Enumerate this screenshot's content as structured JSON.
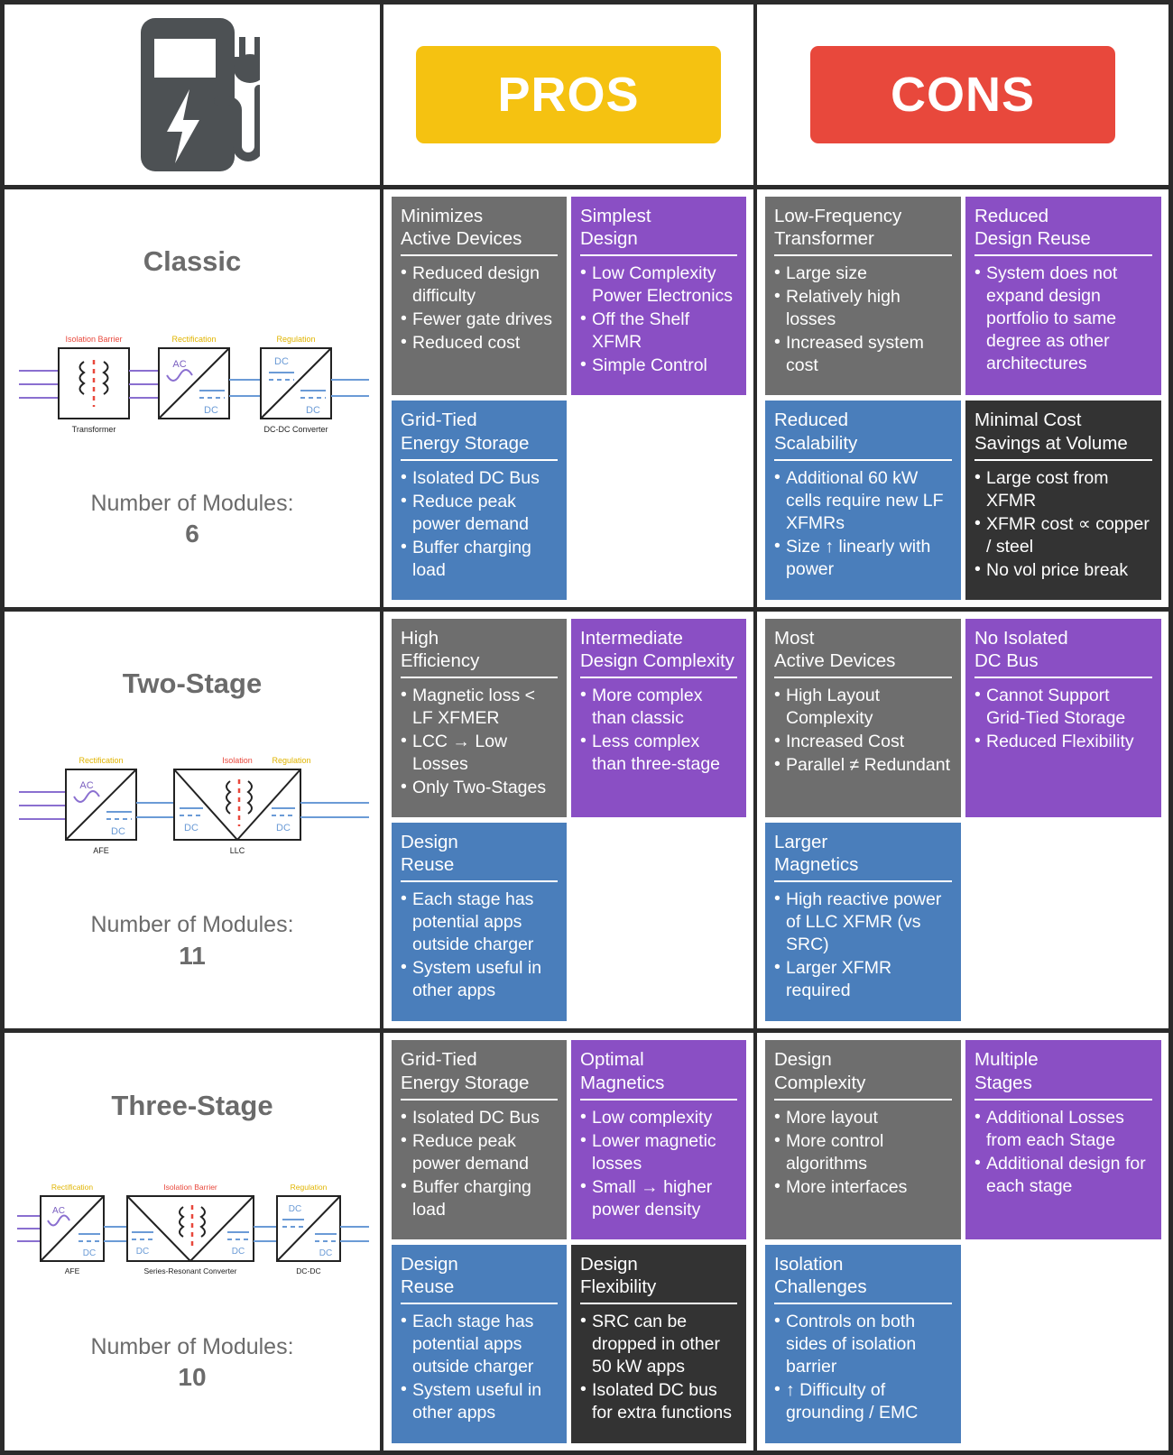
{
  "header": {
    "icon": "ev-charger-icon",
    "pros_label": "PROS",
    "cons_label": "CONS",
    "pros_color": "#f5c211",
    "cons_color": "#e8483c"
  },
  "palette": {
    "gray": "#6e6e6e",
    "purple": "#8a4fc4",
    "blue": "#4a7ebb",
    "dark": "#333333",
    "isolation_label": "#e8483c",
    "stage_label": "#f0c808",
    "ac_line": "#8a6fd0",
    "dc_line": "#6b9bd6"
  },
  "rows": [
    {
      "title": "Classic",
      "modules_label": "Number of Modules:",
      "modules_count": "6",
      "diagram": {
        "blocks": [
          {
            "top_label": "Isolation Barrier",
            "top_label_color": "isolation",
            "bottom_label": "Transformer",
            "kind": "transformer"
          },
          {
            "top_label": "Rectification",
            "top_label_color": "stage",
            "bottom_label": "",
            "kind": "ac-dc"
          },
          {
            "top_label": "Regulation",
            "top_label_color": "stage",
            "bottom_label": "DC-DC Converter",
            "kind": "dc-dc"
          }
        ]
      },
      "pros": [
        {
          "color": "gray",
          "title": "Minimizes\nActive Devices",
          "items": [
            "Reduced design difficulty",
            "Fewer gate drives",
            "Reduced cost"
          ]
        },
        {
          "color": "purple",
          "title": "Simplest\nDesign",
          "items": [
            "Low Complexity Power Electronics",
            "Off the Shelf XFMR",
            "Simple Control"
          ]
        },
        {
          "color": "blue",
          "title": "Grid-Tied\nEnergy Storage",
          "items": [
            "Isolated DC Bus",
            "Reduce peak power demand",
            "Buffer charging load"
          ]
        },
        {
          "color": "empty",
          "title": "",
          "items": []
        }
      ],
      "cons": [
        {
          "color": "gray",
          "title": "Low-Frequency\nTransformer",
          "items": [
            "Large size",
            "Relatively high losses",
            "Increased system cost"
          ]
        },
        {
          "color": "purple",
          "title": "Reduced\nDesign Reuse",
          "items": [
            "System does not expand design portfolio to same degree as other architectures"
          ]
        },
        {
          "color": "blue",
          "title": "Reduced\nScalability",
          "items": [
            "Additional 60 kW cells require new LF XFMRs",
            "Size ↑ linearly with power"
          ]
        },
        {
          "color": "dark",
          "title": "Minimal Cost\nSavings at Volume",
          "items": [
            "Large cost from XFMR",
            "XFMR cost ∝ copper / steel",
            "No vol price break"
          ]
        }
      ]
    },
    {
      "title": "Two-Stage",
      "modules_label": "Number of Modules:",
      "modules_count": "11",
      "diagram": {
        "blocks": [
          {
            "top_label": "Rectification",
            "top_label_color": "stage",
            "bottom_label": "AFE",
            "kind": "ac-dc"
          },
          {
            "top_label": "Isolation  Regulation",
            "top_label_color": "mixed",
            "bottom_label": "LLC",
            "kind": "iso-dc-dc"
          }
        ]
      },
      "pros": [
        {
          "color": "gray",
          "title": "High\nEfficiency",
          "items": [
            "Magnetic loss < LF XFMER",
            "LCC → Low Losses",
            "Only Two-Stages"
          ]
        },
        {
          "color": "purple",
          "title": "Intermediate\nDesign Complexity",
          "items": [
            "More complex than classic",
            "Less complex than three-stage"
          ]
        },
        {
          "color": "blue",
          "title": "Design\nReuse",
          "items": [
            "Each stage has potential apps outside charger",
            "System useful in other apps"
          ]
        },
        {
          "color": "empty",
          "title": "",
          "items": []
        }
      ],
      "cons": [
        {
          "color": "gray",
          "title": "Most\nActive Devices",
          "items": [
            "High Layout Complexity",
            "Increased Cost",
            "Parallel ≠ Redundant"
          ]
        },
        {
          "color": "purple",
          "title": "No Isolated\nDC Bus",
          "items": [
            "Cannot Support Grid-Tied Storage",
            "Reduced Flexibility"
          ]
        },
        {
          "color": "blue",
          "title": "Larger\nMagnetics",
          "items": [
            "High reactive power of LLC XFMR (vs SRC)",
            "Larger XFMR required"
          ]
        },
        {
          "color": "empty",
          "title": "",
          "items": []
        }
      ]
    },
    {
      "title": "Three-Stage",
      "modules_label": "Number of Modules:",
      "modules_count": "10",
      "diagram": {
        "blocks": [
          {
            "top_label": "Rectification",
            "top_label_color": "stage",
            "bottom_label": "AFE",
            "kind": "ac-dc"
          },
          {
            "top_label": "Isolation Barrier",
            "top_label_color": "isolation",
            "bottom_label": "Series-Resonant Converter",
            "kind": "iso-dc-dc"
          },
          {
            "top_label": "Regulation",
            "top_label_color": "stage",
            "bottom_label": "DC-DC",
            "kind": "dc-dc"
          }
        ]
      },
      "pros": [
        {
          "color": "gray",
          "title": "Grid-Tied\nEnergy Storage",
          "items": [
            "Isolated DC Bus",
            "Reduce peak power demand",
            "Buffer charging load"
          ]
        },
        {
          "color": "purple",
          "title": "Optimal\nMagnetics",
          "items": [
            "Low complexity",
            "Lower magnetic losses",
            "Small → higher power density"
          ]
        },
        {
          "color": "blue",
          "title": "Design\nReuse",
          "items": [
            "Each stage has potential apps outside charger",
            "System useful in other apps"
          ]
        },
        {
          "color": "dark",
          "title": "Design\nFlexibility",
          "items": [
            "SRC can be dropped in other 50 kW apps",
            "Isolated DC bus for extra functions"
          ]
        }
      ],
      "cons": [
        {
          "color": "gray",
          "title": "Design\nComplexity",
          "items": [
            "More layout",
            "More control algorithms",
            "More interfaces"
          ]
        },
        {
          "color": "purple",
          "title": "Multiple\nStages",
          "items": [
            "Additional Losses from each Stage",
            "Additional design for each stage"
          ]
        },
        {
          "color": "blue",
          "title": "Isolation\nChallenges",
          "items": [
            "Controls on both sides of isolation barrier",
            "↑ Difficulty of grounding / EMC"
          ]
        },
        {
          "color": "empty",
          "title": "",
          "items": []
        }
      ]
    }
  ],
  "diagram_text": {
    "ac": "AC",
    "dc": "DC"
  }
}
